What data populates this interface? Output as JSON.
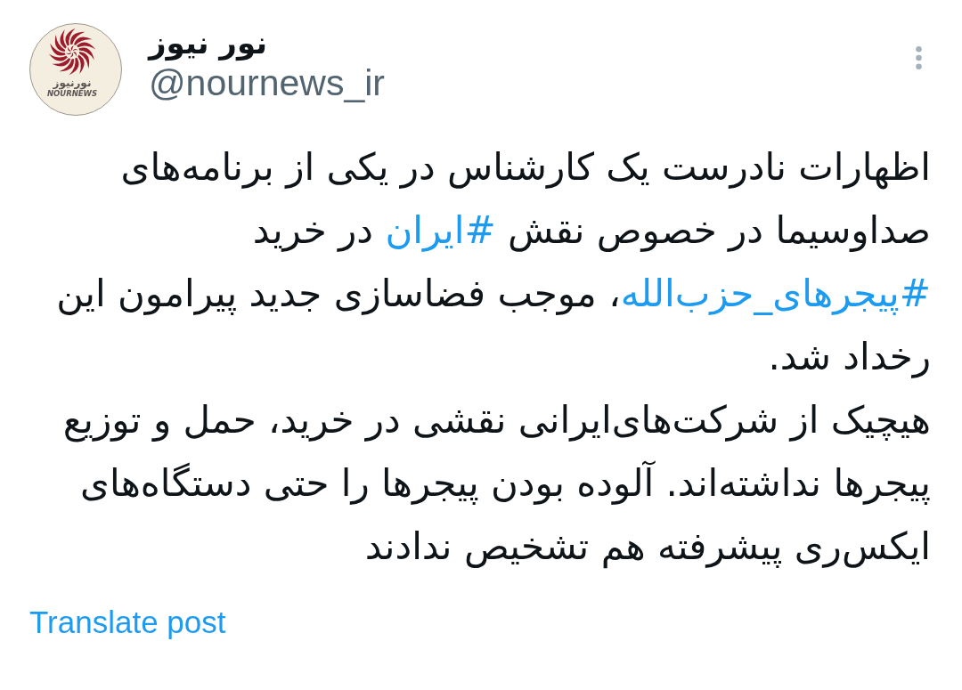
{
  "tweet": {
    "author": {
      "avatar": {
        "wordmark_fa": "نورنیوز",
        "wordmark_en": "NOURNEWS"
      },
      "name": "نور نیوز",
      "handle": "@nournews_ir"
    },
    "paragraphs": [
      [
        {
          "kind": "text",
          "text": "اظهارات نادرست یک کارشناس در یکی از برنامه‌های صداوسیما در خصوص نقش "
        },
        {
          "kind": "hashtag",
          "text": "#ایران"
        },
        {
          "kind": "text",
          "text": " در خرید "
        },
        {
          "kind": "hashtag",
          "text": "#پیجرهای_حزب‌الله"
        },
        {
          "kind": "text",
          "text": "، موجب فضاسازی جدید پیرامون این رخداد شد."
        }
      ],
      [
        {
          "kind": "text",
          "text": "هیچیک از شرکت‌های‌ایرانی نقشی در خرید، حمل و توزیع پیجرها نداشته‌اند. آلوده بودن پیجرها را حتی دستگاه‌های ایکس‌ری پیشرفته هم تشخیص ندادند"
        }
      ]
    ],
    "translate_link": "Translate post"
  }
}
